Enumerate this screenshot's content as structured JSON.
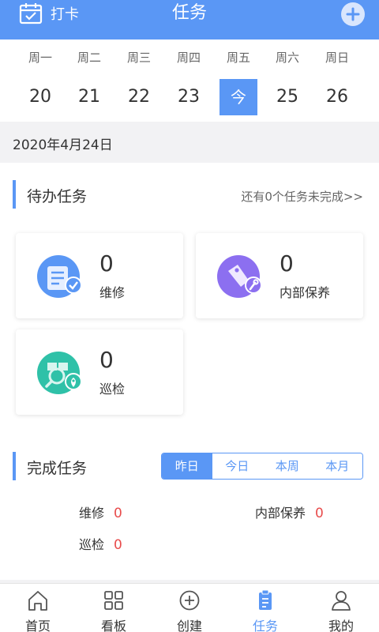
{
  "header": {
    "clockin_label": "打卡",
    "title": "任务",
    "bg_color": "#5a97f5"
  },
  "week": {
    "days": [
      {
        "name": "周一",
        "date": "20"
      },
      {
        "name": "周二",
        "date": "21"
      },
      {
        "name": "周三",
        "date": "22"
      },
      {
        "name": "周四",
        "date": "23"
      },
      {
        "name": "周五",
        "date": "今"
      },
      {
        "name": "周六",
        "date": "25"
      },
      {
        "name": "周日",
        "date": "26"
      }
    ],
    "selected_index": 4
  },
  "current_date": "2020年4月24日",
  "pending": {
    "title": "待办任务",
    "more": "还有0个任务未完成>>",
    "cards": [
      {
        "count": "0",
        "name": "维修",
        "icon": "repair-document-icon"
      },
      {
        "count": "0",
        "name": "内部保养",
        "icon": "maintenance-tag-icon"
      },
      {
        "count": "0",
        "name": "巡检",
        "icon": "inspection-search-icon"
      }
    ]
  },
  "completed": {
    "title": "完成任务",
    "tabs": [
      "昨日",
      "今日",
      "本周",
      "本月"
    ],
    "active_tab": 0,
    "stats": [
      {
        "name": "维修",
        "value": "0"
      },
      {
        "name": "内部保养",
        "value": "0"
      },
      {
        "name": "巡检",
        "value": "0"
      }
    ]
  },
  "nav": {
    "items": [
      {
        "label": "首页",
        "icon": "home-icon"
      },
      {
        "label": "看板",
        "icon": "dashboard-grid-icon"
      },
      {
        "label": "创建",
        "icon": "create-plus-icon"
      },
      {
        "label": "任务",
        "icon": "task-clipboard-icon"
      },
      {
        "label": "我的",
        "icon": "profile-icon"
      }
    ],
    "active_index": 3
  },
  "colors": {
    "accent": "#5a97f5",
    "count_red": "#e84c4c"
  }
}
